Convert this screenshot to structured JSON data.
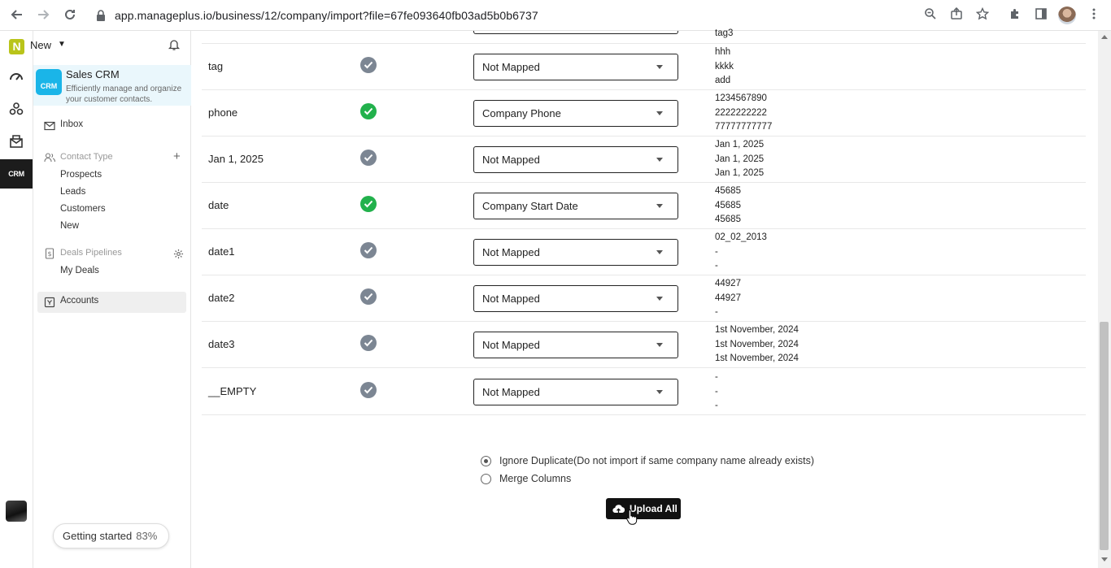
{
  "browser": {
    "url": "app.manageplus.io/business/12/company/import?file=67fe093640fb03ad5b0b6737"
  },
  "topbar": {
    "workspace_label": "New"
  },
  "crm_card": {
    "title": "Sales CRM",
    "description": "Efficiently manage and organize your customer contacts.",
    "logo_text": "CRM"
  },
  "sidebar": {
    "inbox": "Inbox",
    "contact_type_header": "Contact Type",
    "contact_types": [
      "Prospects",
      "Leads",
      "Customers",
      "New"
    ],
    "deals_header": "Deals Pipelines",
    "my_deals": "My Deals",
    "accounts": "Accounts"
  },
  "getting_started": {
    "label": "Getting started",
    "percent": "83%"
  },
  "mapping": {
    "clipped_top_sample": "tag3",
    "rows": [
      {
        "name": "tag",
        "status": "unmapped",
        "field": "Not Mapped",
        "samples": [
          "hhh",
          "kkkk",
          "add"
        ]
      },
      {
        "name": "phone",
        "status": "mapped",
        "field": "Company Phone",
        "samples": [
          "1234567890",
          "2222222222",
          "77777777777"
        ]
      },
      {
        "name": "Jan 1, 2025",
        "status": "unmapped",
        "field": "Not Mapped",
        "samples": [
          "Jan 1, 2025",
          "Jan 1, 2025",
          "Jan 1, 2025"
        ]
      },
      {
        "name": "date",
        "status": "mapped",
        "field": "Company Start Date",
        "samples": [
          "45685",
          "45685",
          "45685"
        ]
      },
      {
        "name": "date1",
        "status": "unmapped",
        "field": "Not Mapped",
        "samples": [
          "02_02_2013",
          "-",
          "-"
        ]
      },
      {
        "name": "date2",
        "status": "unmapped",
        "field": "Not Mapped",
        "samples": [
          "44927",
          "44927",
          "-"
        ]
      },
      {
        "name": "date3",
        "status": "unmapped",
        "field": "Not Mapped",
        "samples": [
          "1st November, 2024",
          "1st November, 2024",
          "1st November, 2024"
        ]
      },
      {
        "name": "__EMPTY",
        "status": "unmapped",
        "field": "Not Mapped",
        "samples": [
          "-",
          "-",
          "-"
        ]
      }
    ]
  },
  "options": {
    "ignore_duplicate": "Ignore Duplicate(Do not import if same company name already exists)",
    "merge_columns": "Merge Columns",
    "selected": "ignore_duplicate"
  },
  "upload_button": "Upload All",
  "colors": {
    "mapped_check": "#22b14c",
    "unmapped_check": "#7c8693",
    "accent": "#1ab5e8"
  }
}
